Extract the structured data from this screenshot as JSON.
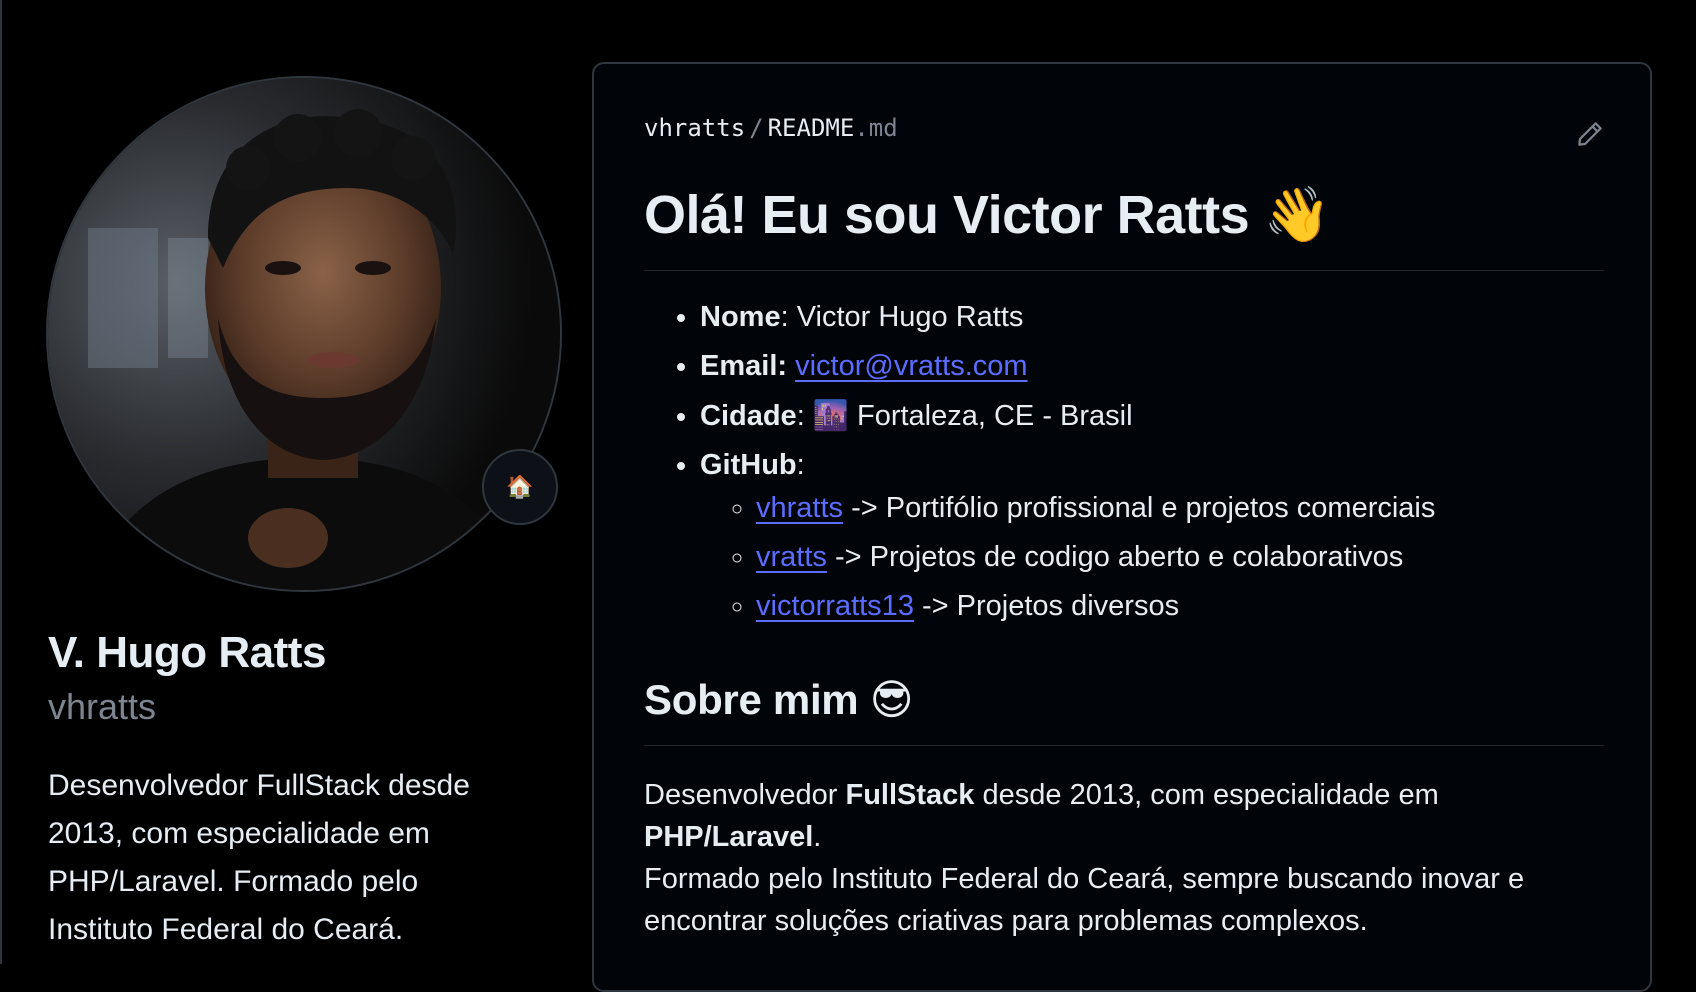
{
  "profile": {
    "display_name": "V. Hugo Ratts",
    "login": "vhratts",
    "status_emoji": "🏠",
    "bio": "Desenvolvedor FullStack desde 2013, com especialidade em PHP/Laravel. Formado pelo Instituto Federal do Ceará."
  },
  "readme": {
    "owner": "vhratts",
    "separator": "/",
    "file_name": "README",
    "file_ext": ".md",
    "edit_icon": "pencil-icon",
    "title": "Olá! Eu sou Victor Ratts",
    "title_emoji": "👋",
    "info": {
      "name_label": "Nome",
      "name_value": ": Victor Hugo Ratts",
      "email_label": "Email:",
      "email_value": "victor@vratts.com",
      "city_label": "Cidade",
      "city_emoji": "🌆",
      "city_value": "Fortaleza, CE - Brasil",
      "github_label": "GitHub",
      "github_colon": ":"
    },
    "github_accounts": [
      {
        "handle": "vhratts",
        "description": "-> Portifólio profissional e projetos comerciais"
      },
      {
        "handle": "vratts",
        "description": "-> Projetos de codigo aberto e colaborativos"
      },
      {
        "handle": "victorratts13",
        "description": "-> Projetos diversos"
      }
    ],
    "about_title": "Sobre mim",
    "about_emoji": "😎",
    "about": {
      "p1": "Desenvolvedor ",
      "p1_bold": "FullStack",
      "p1_rest": " desde 2013, com especialidade em",
      "p2_bold": "PHP/Laravel",
      "p2_rest": ".",
      "p3": "Formado pelo Instituto Federal do Ceará, sempre buscando inovar e encontrar soluções criativas para problemas complexos."
    }
  },
  "colors": {
    "background": "#000000",
    "text": "#e6edf3",
    "muted": "#7d8590",
    "link": "#5c6cff",
    "border": "#30363d"
  }
}
